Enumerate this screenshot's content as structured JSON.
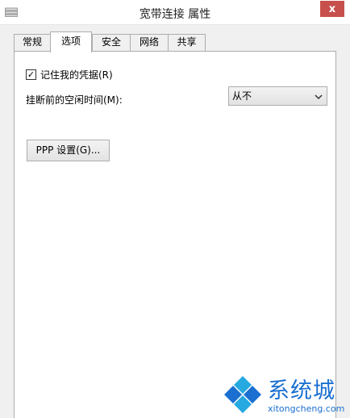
{
  "window": {
    "title": "宽带连接 属性",
    "close_glyph": "x"
  },
  "tabs": [
    {
      "label": "常规"
    },
    {
      "label": "选项"
    },
    {
      "label": "安全"
    },
    {
      "label": "网络"
    },
    {
      "label": "共享"
    }
  ],
  "active_tab": "选项",
  "options": {
    "remember_label": "记住我的凭据(R)",
    "remember_checked": true,
    "check_glyph": "✓",
    "idle_label": "挂断前的空闲时间(M):",
    "idle_value": "从不",
    "ppp_button": "PPP 设置(G)..."
  },
  "watermark": {
    "brand": "系统城",
    "site": "xitongcheng.com",
    "colors": [
      "#1a6fd0",
      "#26a9e0"
    ]
  }
}
